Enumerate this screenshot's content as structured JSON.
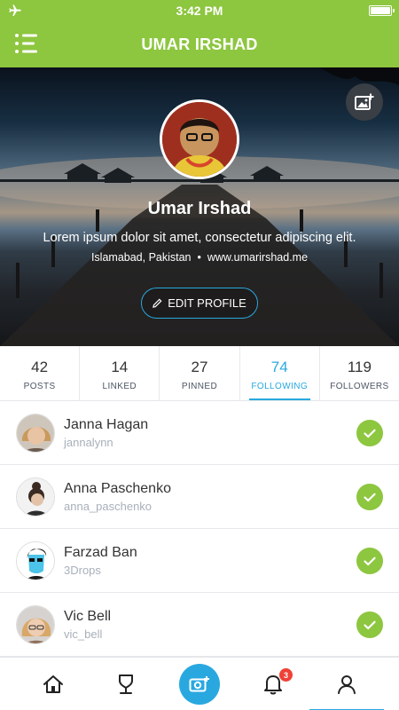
{
  "status_bar": {
    "time": "3:42 PM"
  },
  "nav": {
    "title": "UMAR IRSHAD"
  },
  "profile": {
    "name": "Umar Irshad",
    "bio": "Lorem ipsum dolor sit amet, consectetur adipiscing elit.",
    "location": "Islamabad, Pakistan",
    "separator": "•",
    "website": "www.umarirshad.me",
    "edit_label": "EDIT PROFILE"
  },
  "stats": [
    {
      "value": "42",
      "label": "POSTS"
    },
    {
      "value": "14",
      "label": "LINKED"
    },
    {
      "value": "27",
      "label": "PINNED"
    },
    {
      "value": "74",
      "label": "FOLLOWING",
      "active": true
    },
    {
      "value": "119",
      "label": "FOLLOWERS"
    }
  ],
  "users": [
    {
      "name": "Janna Hagan",
      "handle": "jannalynn",
      "following": true
    },
    {
      "name": "Anna Paschenko",
      "handle": "anna_paschenko",
      "following": true
    },
    {
      "name": "Farzad Ban",
      "handle": "3Drops",
      "following": true
    },
    {
      "name": "Vic Bell",
      "handle": "vic_bell",
      "following": true
    }
  ],
  "tab_bar": {
    "tabs": [
      "home-icon",
      "pin-icon",
      "camera-icon",
      "bell-icon",
      "user-icon"
    ],
    "notification_count": "3",
    "active_tab": "user-icon"
  },
  "colors": {
    "brand_green": "#8dc63f",
    "accent_blue": "#29a8e0",
    "badge_red": "#ef4136"
  }
}
